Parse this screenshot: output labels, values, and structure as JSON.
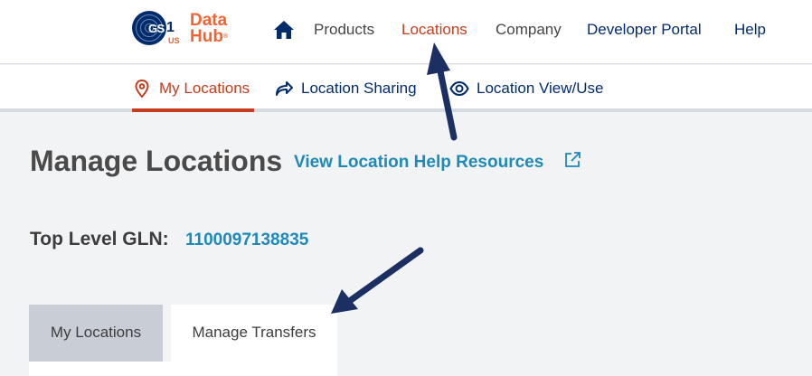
{
  "brand": {
    "gs": "GS",
    "one": "1",
    "us": "US",
    "data": "Data",
    "hub": "Hub",
    "reg": "®",
    "primary_color": "#002c6c",
    "accent_color": "#f26334"
  },
  "topnav": {
    "home_icon": "home-icon",
    "items": [
      {
        "label": "Products"
      },
      {
        "label": "Locations",
        "active": true
      },
      {
        "label": "Company"
      },
      {
        "label": "Developer Portal"
      },
      {
        "label": "Help"
      }
    ]
  },
  "subnav": {
    "items": [
      {
        "label": "My Locations",
        "icon": "map-pin-icon",
        "active": true
      },
      {
        "label": "Location Sharing",
        "icon": "share-arrow-icon"
      },
      {
        "label": "Location View/Use",
        "icon": "eye-icon"
      }
    ]
  },
  "main": {
    "title": "Manage Locations",
    "help_link": "View Location Help Resources",
    "help_link_icon": "external-link-icon",
    "gln_label": "Top Level GLN:",
    "gln_value": "1100097138835"
  },
  "tabs": [
    {
      "label": "My Locations",
      "active": false
    },
    {
      "label": "Manage Transfers",
      "active": true
    }
  ],
  "colors": {
    "active_red": "#c33d1e",
    "link_blue": "#1e8ab8",
    "annotation_arrow": "#1b2f63"
  }
}
